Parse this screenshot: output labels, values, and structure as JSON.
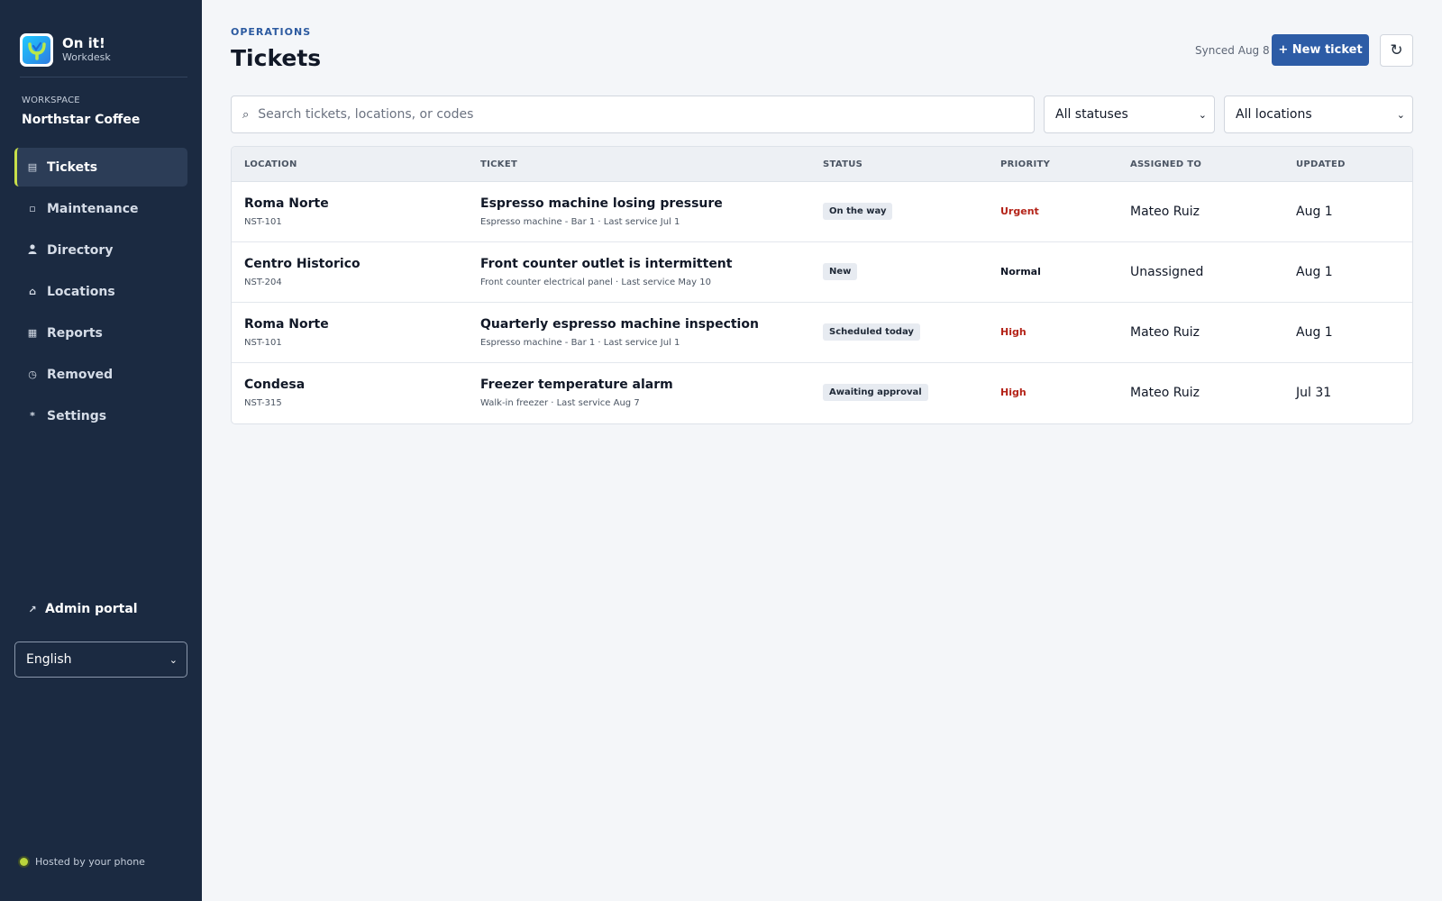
{
  "brand": {
    "title": "On it!",
    "subtitle": "Workdesk"
  },
  "workspace": {
    "label": "WORKSPACE",
    "name": "Northstar Coffee"
  },
  "nav": [
    {
      "label": "Tickets",
      "icon": "list-icon",
      "glyph": "▤",
      "active": true
    },
    {
      "label": "Maintenance",
      "icon": "square-icon",
      "glyph": "▫",
      "active": false
    },
    {
      "label": "Directory",
      "icon": "person-icon",
      "glyph": "👤",
      "active": false
    },
    {
      "label": "Locations",
      "icon": "home-icon",
      "glyph": "⌂",
      "active": false
    },
    {
      "label": "Reports",
      "icon": "grid-icon",
      "glyph": "▦",
      "active": false
    },
    {
      "label": "Removed",
      "icon": "clock-icon",
      "glyph": "◷",
      "active": false
    },
    {
      "label": "Settings",
      "icon": "asterisk-icon",
      "glyph": "*",
      "active": false
    }
  ],
  "admin_portal": "Admin portal",
  "language": "English",
  "hosted": "Hosted by your phone",
  "header": {
    "eyebrow": "OPERATIONS",
    "title": "Tickets",
    "synced": "Synced Aug 8",
    "new_ticket": "+ New ticket",
    "refresh_glyph": "↻"
  },
  "filters": {
    "search_placeholder": "Search tickets, locations, or codes",
    "status": "All statuses",
    "location": "All locations"
  },
  "table": {
    "columns": [
      "LOCATION",
      "TICKET",
      "STATUS",
      "PRIORITY",
      "ASSIGNED TO",
      "UPDATED"
    ],
    "rows": [
      {
        "location": "Roma Norte",
        "code": "NST-101",
        "title": "Espresso machine losing pressure",
        "sub": "Espresso machine - Bar 1 · Last service Jul 1",
        "status": "On the way",
        "priority": "Urgent",
        "assigned": "Mateo Ruiz",
        "updated": "Aug 1"
      },
      {
        "location": "Centro Historico",
        "code": "NST-204",
        "title": "Front counter outlet is intermittent",
        "sub": "Front counter electrical panel · Last service May 10",
        "status": "New",
        "priority": "Normal",
        "assigned": "Unassigned",
        "updated": "Aug 1"
      },
      {
        "location": "Roma Norte",
        "code": "NST-101",
        "title": "Quarterly espresso machine inspection",
        "sub": "Espresso machine - Bar 1 · Last service Jul 1",
        "status": "Scheduled today",
        "priority": "High",
        "assigned": "Mateo Ruiz",
        "updated": "Aug 1"
      },
      {
        "location": "Condesa",
        "code": "NST-315",
        "title": "Freezer temperature alarm",
        "sub": "Walk-in freezer · Last service Aug 7",
        "status": "Awaiting approval",
        "priority": "High",
        "assigned": "Mateo Ruiz",
        "updated": "Jul 31"
      }
    ]
  },
  "colors": {
    "sidebar": "#1b2a41",
    "accent": "#2d5ca6",
    "active_marker": "#c8df4a",
    "priority_high": "#b42318",
    "priority_normal": "#111827"
  }
}
